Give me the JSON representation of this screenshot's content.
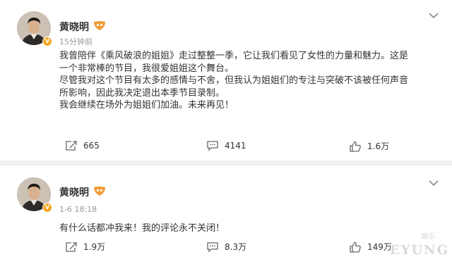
{
  "posts": [
    {
      "author": "黄晓明",
      "time": "15分钟前",
      "lines": [
        "我曾陪伴《乘风破浪的姐姐》走过整整一季，它让我们看见了女性的力量和魅力。这是",
        "一个非常棒的节目，我很爱姐姐这个舞台。",
        "尽管我对这个节目有太多的感情与不舍，但我认为姐姐们的专注与突破不该被任何声音",
        "所影响，因此我决定退出本季节目录制。",
        "我会继续在场外为姐姐们加油。未来再见！"
      ],
      "repost_count": "665",
      "comment_count": "4141",
      "like_count": "1.6万"
    },
    {
      "author": "黄晓明",
      "time": "1-6 18:18",
      "lines": [
        "有什么话都冲我来！我的评论永不关闭！"
      ],
      "repost_count": "1.9万",
      "comment_count": "8.3万",
      "like_count": "149万"
    }
  ],
  "watermark": "EYUNG",
  "watermark_small": "娱乐",
  "icons": {
    "verified": "verified-badge-icon",
    "level": "level-medal-icon",
    "more": "chevron-down-icon",
    "repost": "repost-icon",
    "comment": "comment-icon",
    "like": "thumbs-up-icon"
  },
  "colors": {
    "badge": "#f5a623",
    "background": "#f2f2f2",
    "card": "#ffffff",
    "time": "#999999"
  }
}
